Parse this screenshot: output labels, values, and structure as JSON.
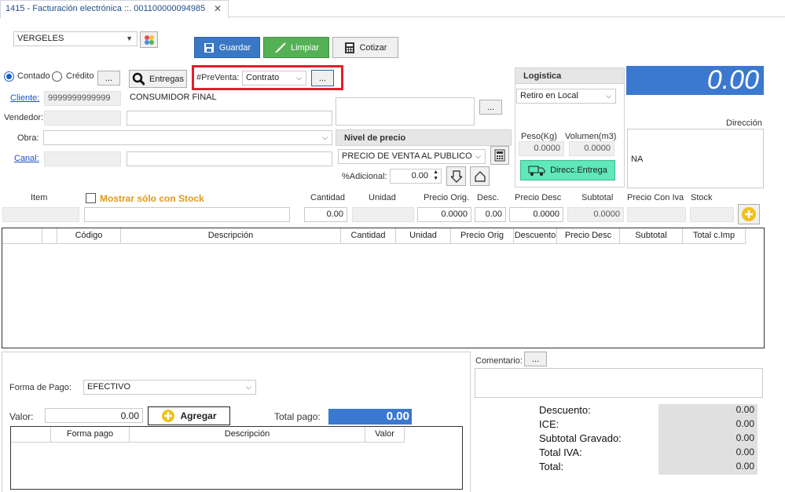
{
  "tab": {
    "title": "1415 - Facturación electrónica ::. 001100000094985",
    "close": "✕"
  },
  "warehouse": {
    "value": "VERGELES"
  },
  "toolbar": {
    "save": "Guardar",
    "clear": "Limpiar",
    "quote": "Cotizar"
  },
  "payment_type": {
    "cash": "Contado",
    "credit": "Crédito",
    "dots": "...",
    "deliveries": "Entregas"
  },
  "presale": {
    "label": "#PreVenta:",
    "value": "Contrato",
    "dots": "..."
  },
  "fields": {
    "client_label": "Cliente:",
    "client_id": "9999999999999",
    "client_name": "CONSUMIDOR FINAL",
    "seller_label": "Vendedor:",
    "work_label": "Obra:",
    "channel_label": "Canal:"
  },
  "notes_dots": "...",
  "price_level": {
    "header": "Nivel de precio",
    "value": "PRECIO DE VENTA AL PUBLICO",
    "additional_label": "%Adicional:",
    "additional_value": "0.00"
  },
  "logistics": {
    "header": "Logistica",
    "mode": "Retiro en Local",
    "weight_label": "Peso(Kg)",
    "weight_value": "0.0000",
    "volume_label": "Volumen(m3)",
    "volume_value": "0.0000",
    "delivery_button": "Direcc.Entrega"
  },
  "total_display": "0.00",
  "address": {
    "label": "Dirección",
    "value": "NA"
  },
  "item_entry": {
    "item_label": "Item",
    "stock_only": "Mostrar sólo con Stock",
    "qty_label": "Cantidad",
    "qty_value": "0.00",
    "unit_label": "Unidad",
    "orig_price_label": "Precio Orig.",
    "orig_price_value": "0.0000",
    "disc_label": "Desc.",
    "disc_value": "0.00",
    "disc_price_label": "Precio Desc",
    "disc_price_value": "0.0000",
    "subtotal_label": "Subtotal",
    "subtotal_value": "0.0000",
    "price_iva_label": "Precio Con Iva",
    "stock_label": "Stock"
  },
  "items_grid": {
    "columns": [
      "",
      "",
      "Código",
      "Descripción",
      "Cantidad",
      "Unidad",
      "Precio Orig",
      "Descuento",
      "Precio Desc",
      "Subtotal",
      "Total c.Imp"
    ]
  },
  "payment": {
    "method_label": "Forma de Pago:",
    "method_value": "EFECTIVO",
    "amount_label": "Valor:",
    "amount_value": "0.00",
    "add_button": "Agregar",
    "total_label": "Total pago:",
    "total_value": "0.00",
    "grid_columns": [
      "",
      "Forma pago",
      "Descripción",
      "Valor"
    ]
  },
  "comment": {
    "label": "Comentario:",
    "dots": "..."
  },
  "summary": [
    {
      "label": "Descuento:",
      "value": "0.00"
    },
    {
      "label": "ICE:",
      "value": "0.00"
    },
    {
      "label": "Subtotal Gravado:",
      "value": "0.00"
    },
    {
      "label": "Total IVA:",
      "value": "0.00"
    },
    {
      "label": "Total:",
      "value": "0.00"
    }
  ],
  "colors": {
    "save_button": "#3a78c4",
    "clear_button": "#55b155",
    "total_bg": "#3b78d0",
    "highlight": "#e0202a",
    "delivery_button": "#5fe8b8"
  }
}
